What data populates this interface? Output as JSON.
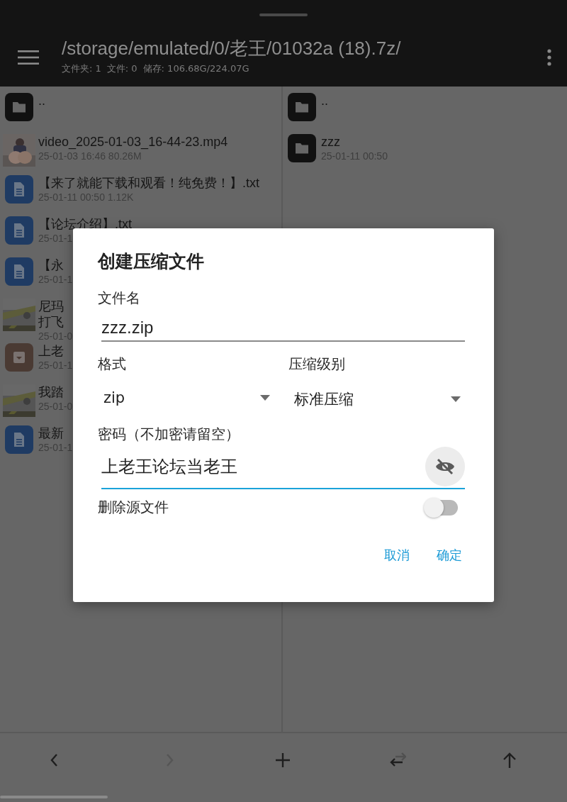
{
  "top_bar": {
    "path": "/storage/emulated/0/老王/01032a (18).7z/",
    "stats": [
      "文件夹: 1",
      "文件: 0",
      "储存: 106.68G/224.07G"
    ]
  },
  "left_pane": {
    "items": [
      {
        "kind": "folder",
        "name": ".."
      },
      {
        "kind": "video",
        "name": "video_2025-01-03_16-44-23.mp4",
        "meta": "25-01-03 16:46  80.26M"
      },
      {
        "kind": "text",
        "name": "【来了就能下载和观看！纯免费！】.txt",
        "meta": "25-01-11 00:50  1.12K"
      },
      {
        "kind": "text",
        "name": "【论坛介绍】.txt",
        "meta": "25-01-1"
      },
      {
        "kind": "text",
        "name": "【永",
        "meta": "25-01-1"
      },
      {
        "name": "尼玛",
        "name_line2": "打飞",
        "meta": "25-01-0"
      },
      {
        "kind": "archive",
        "name": "上老",
        "meta": "25-01-1"
      },
      {
        "name": "我踏",
        "meta": "25-01-0"
      },
      {
        "kind": "text",
        "name": "最新",
        "meta": "25-01-1"
      }
    ]
  },
  "right_pane": {
    "items": [
      {
        "kind": "folder",
        "name": ".."
      },
      {
        "kind": "folder",
        "name": "zzz",
        "meta": "25-01-11 00:50"
      }
    ]
  },
  "dialog": {
    "title": "创建压缩文件",
    "filename_label": "文件名",
    "filename": "zzz.zip",
    "format_label": "格式",
    "format": "zip",
    "level_label": "压缩级别",
    "level_value": "标准压缩",
    "password_label": "密码（不加密请留空）",
    "password": "上老王论坛当老王",
    "password_visible": true,
    "delete_label": "删除源文件",
    "delete_source": false,
    "buttons": [
      "取消",
      "确定"
    ]
  },
  "bottom_bar": [
    {
      "kind": "back",
      "disabled": false
    },
    {
      "kind": "forward",
      "disabled": true
    },
    {
      "kind": "add",
      "disabled": false
    },
    {
      "kind": "swap",
      "disabled": false
    },
    {
      "kind": "up",
      "disabled": false
    }
  ]
}
